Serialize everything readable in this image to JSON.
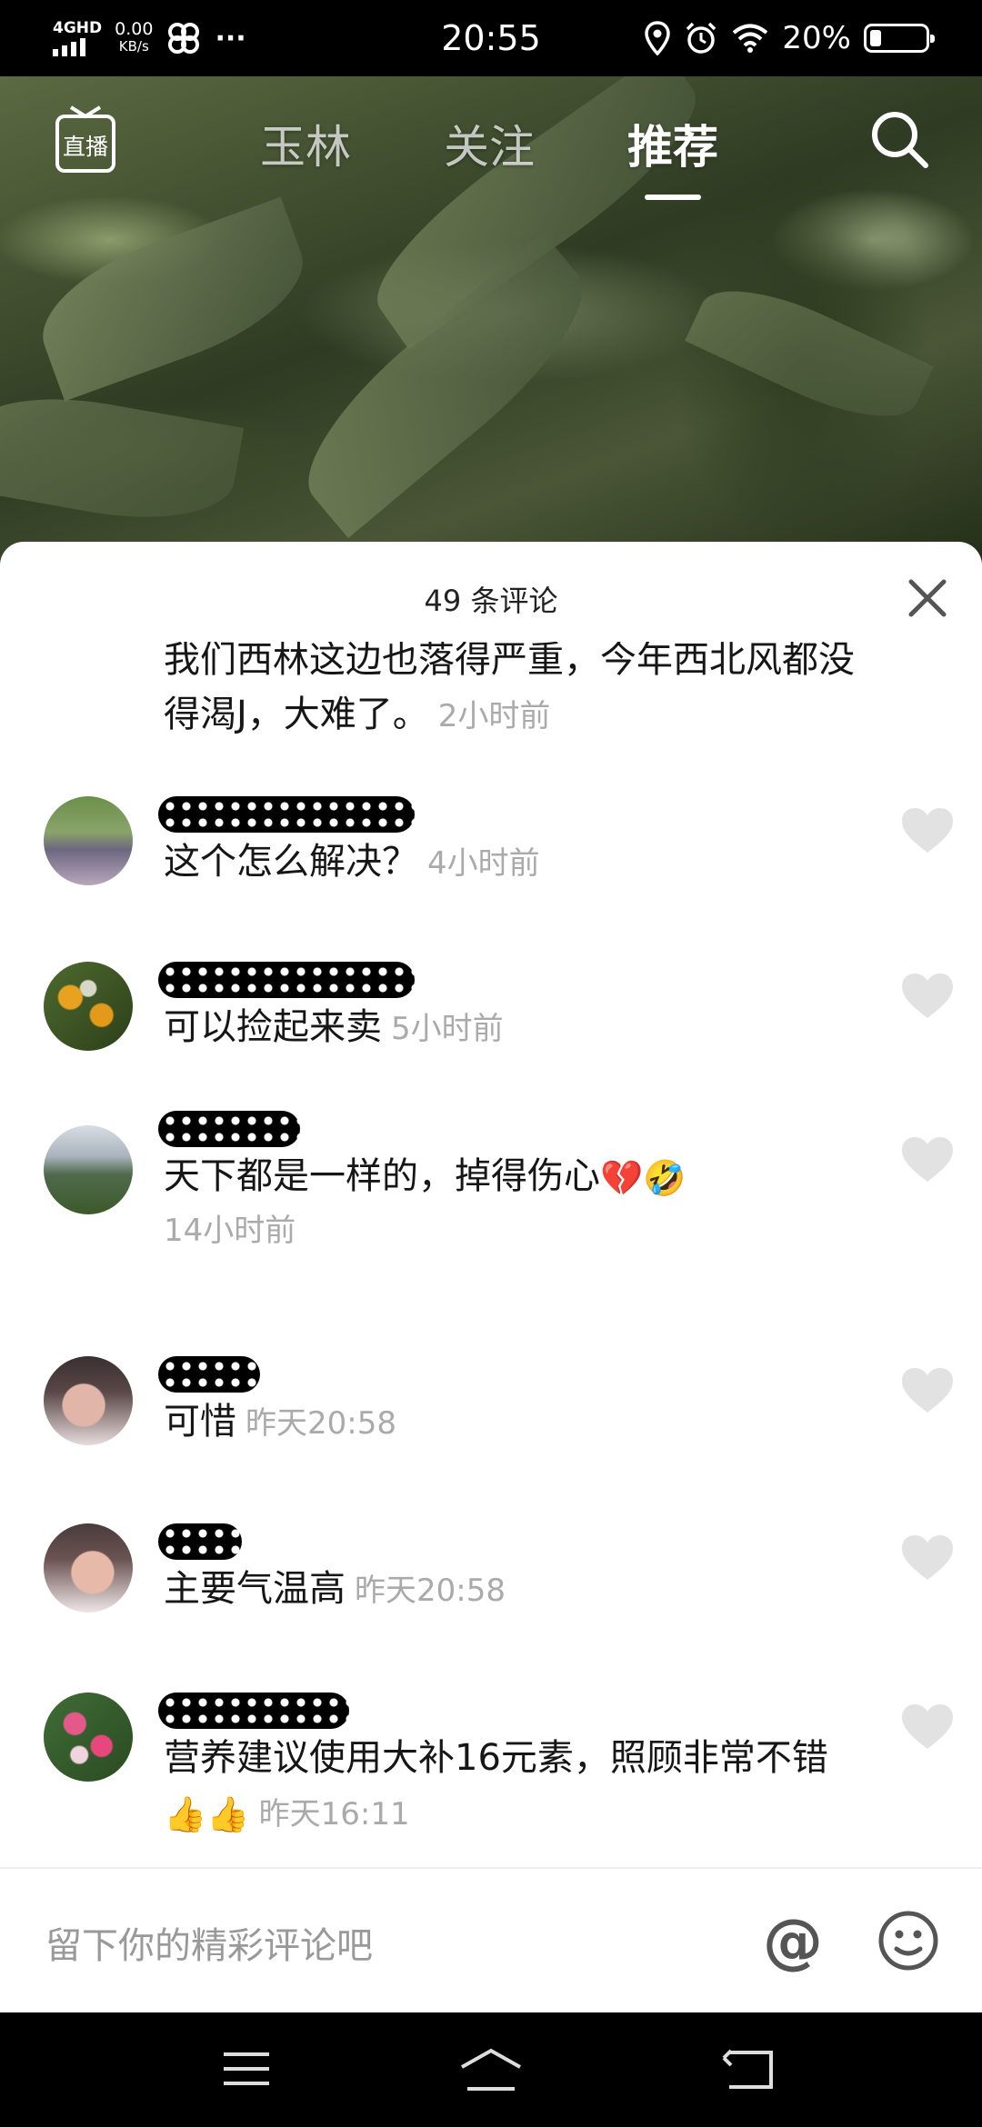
{
  "status_bar": {
    "network": "4GHD",
    "speed_value": "0.00",
    "speed_unit": "KB/s",
    "more": "···",
    "time": "20:55",
    "battery_percent": "20%",
    "battery_level": 0.2
  },
  "top_nav": {
    "live_label": "直播",
    "tabs": [
      {
        "label": "玉林",
        "active": false
      },
      {
        "label": "关注",
        "active": false
      },
      {
        "label": "推荐",
        "active": true
      }
    ]
  },
  "comments_panel": {
    "title": "49 条评论",
    "comments": [
      {
        "text": "我们西林这边也落得严重，今年西北风都没得渴J，大难了。",
        "time": "2小时前"
      },
      {
        "text": "这个怎么解决？",
        "time": "4小时前"
      },
      {
        "text": "可以捡起来卖",
        "time": "5小时前"
      },
      {
        "text": "天下都是一样的，掉得伤心",
        "emojis": "💔🤣",
        "time": "14小时前"
      },
      {
        "text": "可惜",
        "time": "昨天20:58"
      },
      {
        "text": "主要气温高",
        "time": "昨天20:58"
      },
      {
        "text": "营养建议使用大补16元素，照顾非常不错",
        "emojis": "👍👍",
        "time": "昨天16:11"
      }
    ],
    "input_placeholder": "留下你的精彩评论吧",
    "at_symbol": "@"
  },
  "colors": {
    "accent_text": "#161616",
    "secondary_text": "#aaaaaa",
    "sheet_bg": "#ffffff"
  }
}
